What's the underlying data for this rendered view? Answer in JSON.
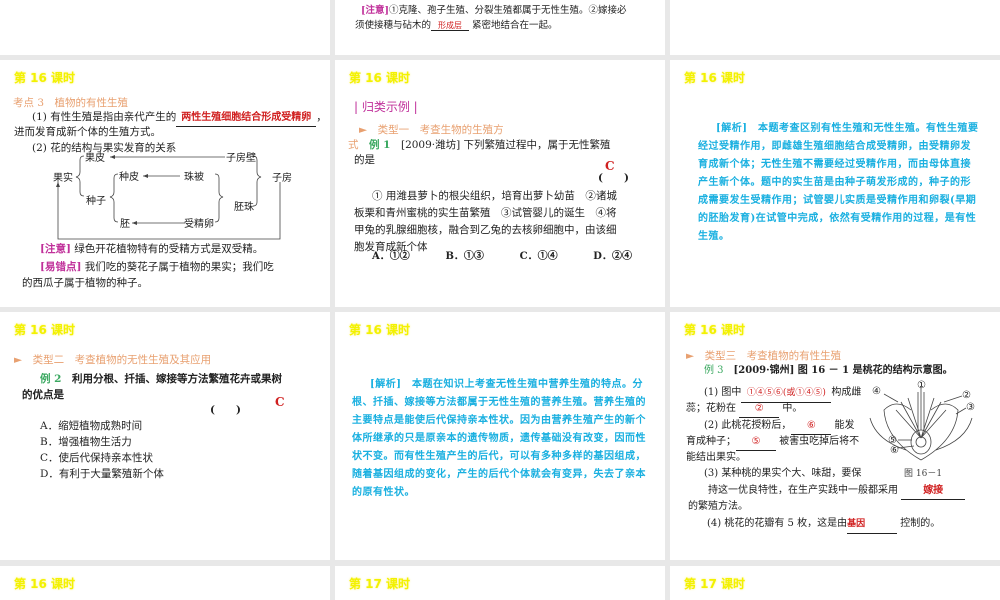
{
  "slides": [
    {
      "note_tag": "[注意]",
      "note_a": "①克隆、孢子生殖、分裂生殖都属于无性生殖。②嫁接必",
      "note_b1": "须使接穗与砧木的",
      "note_answer": "形成层",
      "note_b2": "紧密地结合在一起。"
    },
    {
      "header": "第 16 课时",
      "title": "考点 3　植物的有性生殖",
      "p1a": "(1) 有性生殖是指由亲代产生的",
      "p1ans": "两性生殖细胞结合形成受精卵",
      "p1b": "，",
      "p1c": "进而发育成新个体的生殖方式。",
      "p2": "(2) 花的结构与果实发育的关系",
      "diagram": {
        "guopi": "果皮",
        "zifangbi": "子房壁",
        "guoshi": "果实",
        "zhongpi": "种皮",
        "zhubei": "珠被",
        "zifang": "子房",
        "zhongzi": "种子",
        "peizhu": "胚珠",
        "pei": "胚",
        "shoujingluan": "受精卵"
      },
      "note_tag": "[注意]",
      "note": "绿色开花植物特有的受精方式是双受精。",
      "err_tag": "[易错点]",
      "err_a": "我们吃的葵花子属于植物的果实；我们吃",
      "err_b": "的西瓜子属于植物的种子。"
    },
    {
      "header": "第 16 课时",
      "section": "| 归类示例 |",
      "type": "►　类型一　考查生物的生殖方",
      "type2": "式",
      "ex": "例 1",
      "q_a": "[2009·潍坊] 下列繁殖过程中，属于无性繁殖",
      "q_b": "的是",
      "answer": "C",
      "paren": "(　　)",
      "opts_a": "① 用潍县萝卜的根尖组织，培育出萝卜幼苗　②诸城",
      "opts_b": "板栗和青州蜜桃的实生苗繁殖　③试管婴儿的诞生　④将",
      "opts_c": "甲兔的乳腺细胞核，融合到乙兔的去核卵细胞中，由该细",
      "opts_d": "胞发育成新个体",
      "choices": [
        "A．①②",
        "B．①③",
        "C．①④",
        "D．②④"
      ]
    },
    {
      "header": "第 16 课时",
      "tag": "[解析]",
      "text": "本题考查区别有性生殖和无性生殖。有性生殖要经过受精作用，即雌雄生殖细胞结合成受精卵，由受精卵发育成新个体；无性生殖不需要经过受精作用，而由母体直接产生新个体。题中的实生苗是由种子萌发形成的，种子的形成需要发生受精作用；试管婴儿实质是受精作用和卵裂(早期的胚胎发育)在试管中完成，依然有受精作用的过程，是有性生殖。"
    },
    {
      "header": "第 16 课时",
      "type": "►　类型二　考查植物的无性生殖及其应用",
      "ex": "例 2",
      "q_a": "利用分根、扦插、嫁接等方法繁殖花卉或果树",
      "q_b": "的优点是",
      "answer": "C",
      "paren": "(　　)",
      "choices": [
        "A．缩短植物成熟时间",
        "B．增强植物生活力",
        "C．使后代保持亲本性状",
        "D．有利于大量繁殖新个体"
      ]
    },
    {
      "header": "第 16 课时",
      "tag": "[解析]",
      "text": "本题在知识上考查无性生殖中营养生殖的特点。分根、扦插、嫁接等方法都属于无性生殖的营养生殖。营养生殖的主要特点是能使后代保持亲本性状。因为由营养生殖产生的新个体所继承的只是原亲本的遗传物质，遗传基础没有改变，因而性状不变。而有性生殖产生的后代，可以有多种多样的基因组成，随着基因组成的变化，产生的后代个体就会有变异，失去了亲本的原有性状。"
    },
    {
      "header": "第 16 课时",
      "type": "►　类型三　考查植物的有性生殖",
      "ex": "例 3",
      "q": "[2009·锦州] 图 16 － 1 是桃花的结构示意图。",
      "q1a": "(1) 图中",
      "q1ans": "①④⑤⑥(或①④⑤)",
      "q1b": "构成雌",
      "q1c": "蕊；花粉在",
      "q1ans2": "②",
      "q1d": "中。",
      "q2a": "(2) 此桃花授粉后，",
      "q2ans": "⑥",
      "q2b": "能发",
      "q2c": "育成种子；",
      "q2ans2": "⑤",
      "q2d": "被害虫吃掉后将不",
      "q2e": "能结出果实。",
      "q3a": "(3) 某种桃的果实个大、味甜，要保",
      "q3b": "持这一优良特性，在生产实践中一般都采用",
      "q3ans": "嫁接",
      "q3c": "的繁殖方法。",
      "q4a": "(4) 桃花的花瓣有 5 枚，这是由",
      "q4ans": "基因",
      "q4b": "控制的。",
      "fig_caption": "图 16－1",
      "fig_labels": [
        "①",
        "②",
        "③",
        "④",
        "⑤",
        "⑥"
      ]
    },
    {
      "header": "第 16 课时"
    },
    {
      "header": "第 17 课时"
    },
    {
      "header": "第 17 课时"
    }
  ]
}
